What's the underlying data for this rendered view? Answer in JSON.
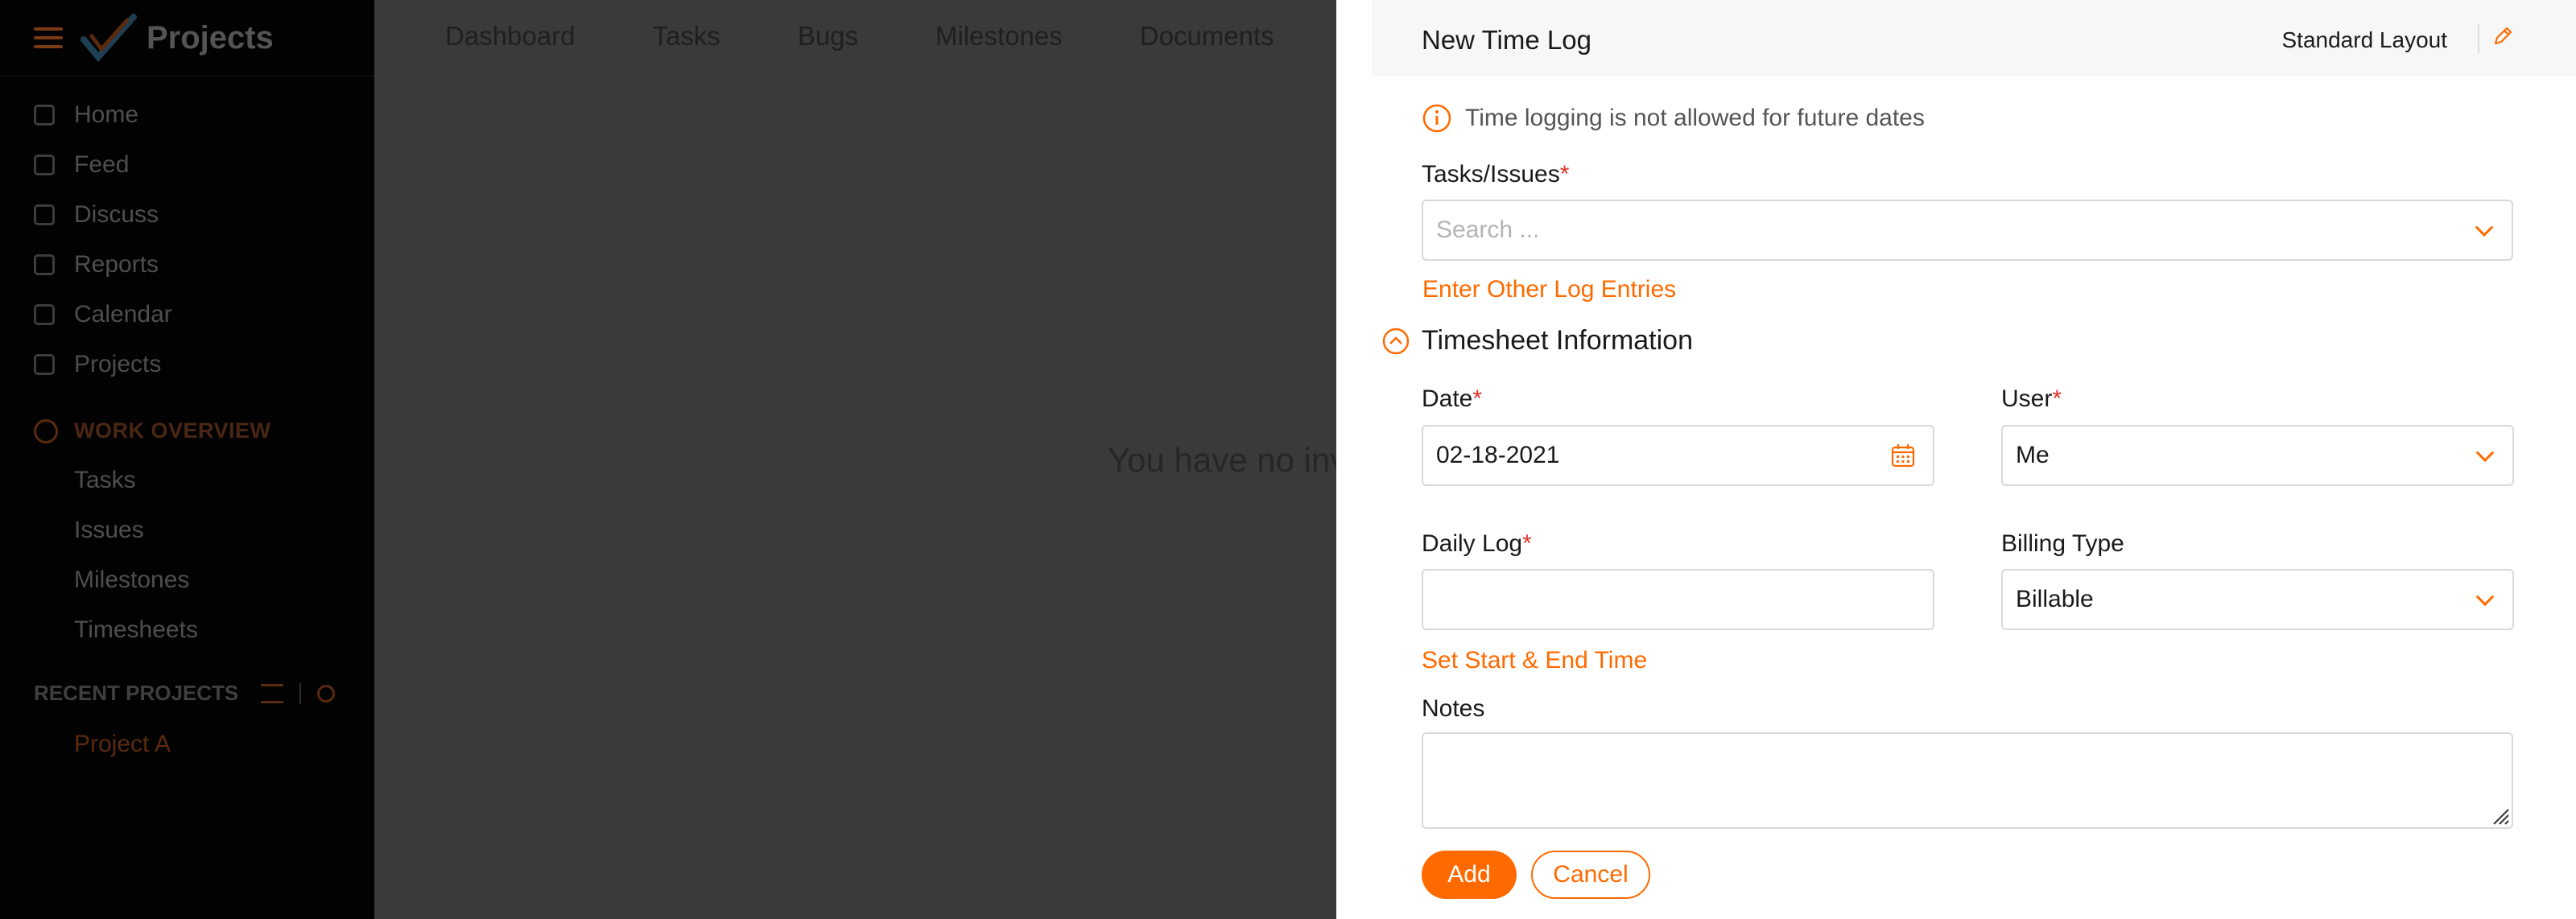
{
  "app": {
    "title": "Projects",
    "sidebar": {
      "items": [
        {
          "label": "Home",
          "icon": "home-icon"
        },
        {
          "label": "Feed",
          "icon": "feed-icon"
        },
        {
          "label": "Discuss",
          "icon": "discuss-icon"
        },
        {
          "label": "Reports",
          "icon": "reports-icon"
        },
        {
          "label": "Calendar",
          "icon": "calendar-icon"
        },
        {
          "label": "Projects",
          "icon": "projects-icon"
        }
      ],
      "work_overview": {
        "title": "WORK OVERVIEW",
        "items": [
          "Tasks",
          "Issues",
          "Milestones",
          "Timesheets"
        ]
      },
      "recent_projects": {
        "title": "RECENT PROJECTS",
        "items": [
          "Project A"
        ]
      }
    },
    "topnav": [
      "Dashboard",
      "Tasks",
      "Bugs",
      "Milestones",
      "Documents"
    ],
    "empty_message": "You have no inv"
  },
  "panel": {
    "title": "New Time Log",
    "layout": "Standard Layout",
    "info": "Time logging is not allowed for future dates",
    "tasks": {
      "label": "Tasks/Issues",
      "required": "*",
      "placeholder": "Search ..."
    },
    "other_entries_link": "Enter Other Log Entries",
    "section_title": "Timesheet Information",
    "date": {
      "label": "Date",
      "required": "*",
      "value": "02-18-2021"
    },
    "user": {
      "label": "User",
      "required": "*",
      "value": "Me"
    },
    "daily_log": {
      "label": "Daily Log",
      "required": "*",
      "value": ""
    },
    "billing_type": {
      "label": "Billing Type",
      "value": "Billable"
    },
    "start_end_link": "Set Start & End Time",
    "notes": {
      "label": "Notes",
      "value": ""
    },
    "buttons": {
      "add": "Add",
      "cancel": "Cancel"
    }
  },
  "colors": {
    "accent": "#ff6a00",
    "required": "#e0322a",
    "overlay_bg": "#3a3a3a",
    "sidebar_bg": "#020202"
  }
}
